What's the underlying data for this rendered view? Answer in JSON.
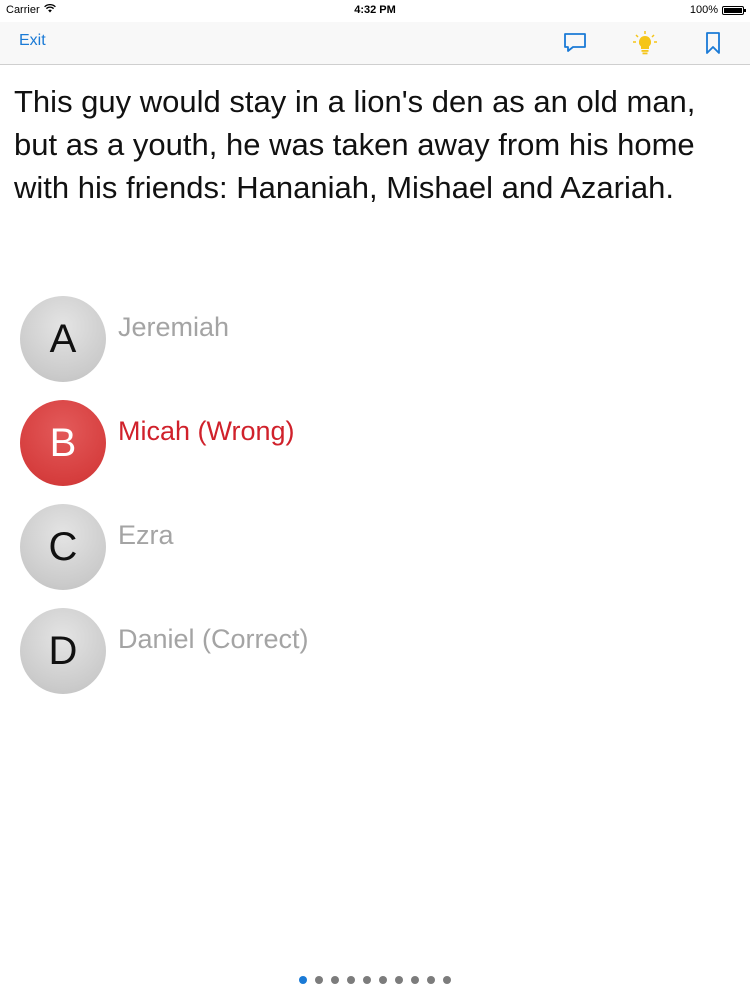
{
  "status_bar": {
    "carrier": "Carrier",
    "time": "4:32 PM",
    "battery_percent": "100%"
  },
  "toolbar": {
    "exit_label": "Exit",
    "icons": [
      "chat-bubble-icon",
      "lightbulb-icon",
      "bookmark-icon"
    ]
  },
  "question": {
    "text": "This guy would stay in a lion's den as an old man, but as a youth, he was taken away from his home with his friends: Hananiah, Mishael and Azariah."
  },
  "answers": [
    {
      "letter": "A",
      "text": "Jeremiah",
      "state": "neutral"
    },
    {
      "letter": "B",
      "text": "Micah (Wrong)",
      "state": "wrong"
    },
    {
      "letter": "C",
      "text": "Ezra",
      "state": "neutral"
    },
    {
      "letter": "D",
      "text": "Daniel (Correct)",
      "state": "neutral"
    }
  ],
  "pagination": {
    "total": 10,
    "current": 1
  },
  "colors": {
    "accent": "#1a7ad6",
    "wrong": "#d0212b",
    "bulb": "#f5c518"
  }
}
